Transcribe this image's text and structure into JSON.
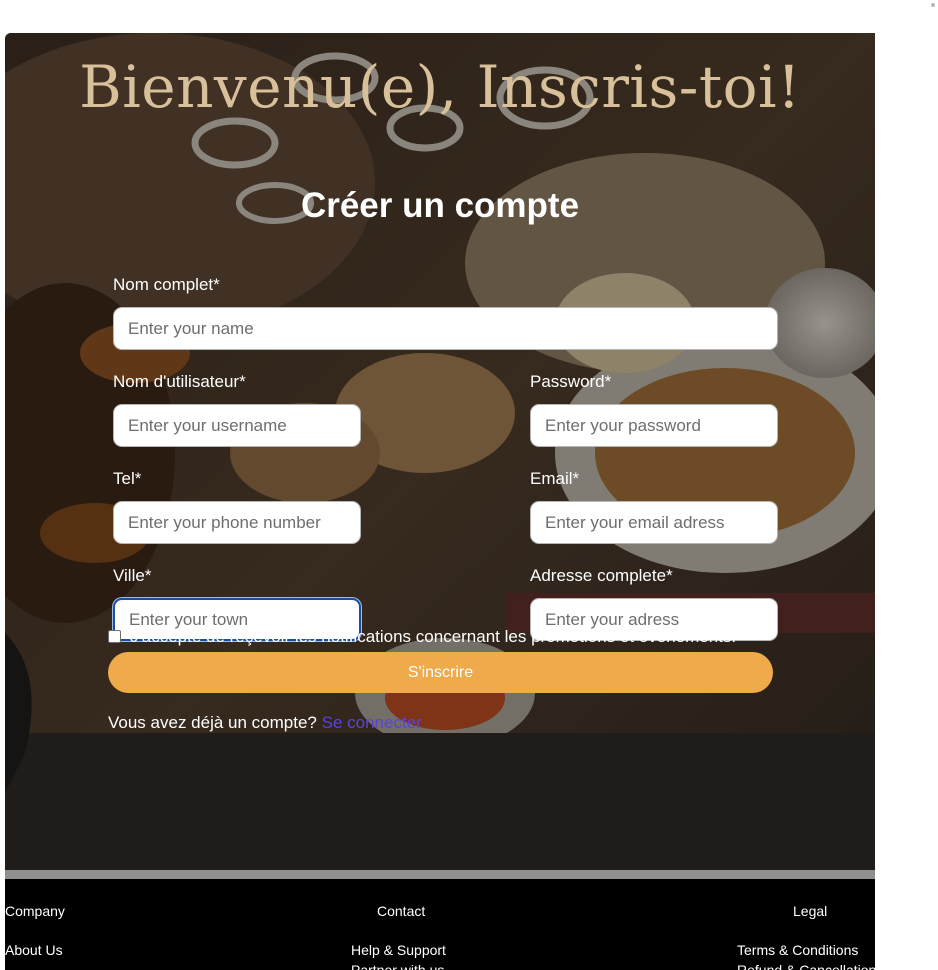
{
  "headline": "Bienvenu(e), Inscris-toi!",
  "form": {
    "title": "Créer un compte",
    "fields": {
      "full_name": {
        "label": "Nom complet*",
        "placeholder": "Enter your name",
        "value": ""
      },
      "username": {
        "label": "Nom d'utilisateur*",
        "placeholder": "Enter your username",
        "value": ""
      },
      "password": {
        "label": "Password*",
        "placeholder": "Enter your password",
        "value": ""
      },
      "phone": {
        "label": "Tel*",
        "placeholder": "Enter your phone number",
        "value": ""
      },
      "email": {
        "label": "Email*",
        "placeholder": "Enter your email adress",
        "value": ""
      },
      "town": {
        "label": "Ville*",
        "placeholder": "Enter your town",
        "value": ""
      },
      "address": {
        "label": "Adresse complete*",
        "placeholder": "Enter your adress",
        "value": ""
      }
    },
    "consent": {
      "label": "J'accepte de reçevoir les notifications concernant les promotions et évènements.",
      "checked": false
    },
    "submit_label": "S'inscrire",
    "login_prompt": "Vous avez déjà un compte?",
    "login_link": "Se connecter"
  },
  "footer": {
    "columns": [
      {
        "heading": "Company",
        "links": [
          "About Us"
        ]
      },
      {
        "heading": "Contact",
        "links": [
          "Help & Support",
          "Partner with us"
        ]
      },
      {
        "heading": "Legal",
        "links": [
          "Terms & Conditions",
          "Refund & Cancellation"
        ]
      }
    ]
  },
  "colors": {
    "headline": "#d7c09a",
    "submit_button": "#eeaa4b",
    "login_link": "#5a43d9",
    "footer_bg": "#000000",
    "focus_ring": "#1a4fa0"
  }
}
